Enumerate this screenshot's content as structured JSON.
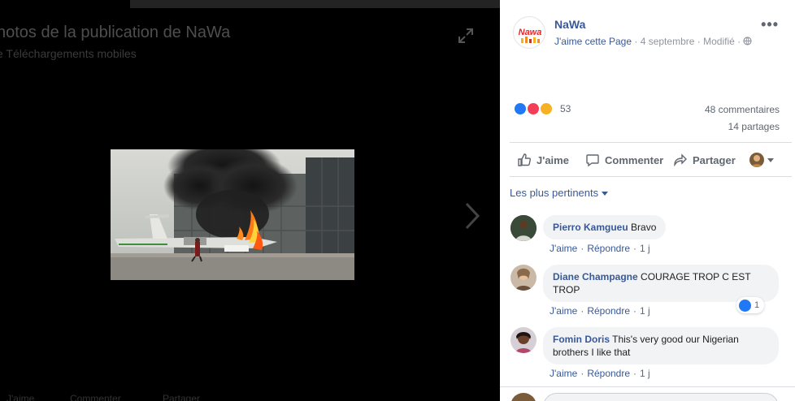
{
  "viewer": {
    "title": "hotos de la publication de NaWa",
    "subtitle": "e Téléchargements mobiles",
    "bottom_actions": [
      "J'aime",
      "Commenter",
      "Partager"
    ]
  },
  "post": {
    "page_name": "NaWa",
    "like_page": "J'aime cette Page",
    "date": "4 septembre",
    "edited": "Modifié",
    "privacy_icon": "globe-icon",
    "logo_text": "Nawa",
    "reaction_count": "53",
    "comments_count": "48 commentaires",
    "shares_count": "14 partages",
    "actions": {
      "like": "J'aime",
      "comment": "Commenter",
      "share": "Partager"
    }
  },
  "comments_section": {
    "filter_label": "Les plus pertinents",
    "comments": [
      {
        "author": "Pierro Kamgueu",
        "text": "Bravo",
        "like": "J'aime",
        "reply": "Répondre",
        "time": "1 j"
      },
      {
        "author": "Diane Champagne",
        "text": "COURAGE TROP C EST TROP",
        "like": "J'aime",
        "reply": "Répondre",
        "time": "1 j",
        "likes": "1"
      },
      {
        "author": "Fomin Doris",
        "text": "This's very good our Nigerian brothers I like that",
        "like": "J'aime",
        "reply": "Répondre",
        "time": "1 j"
      }
    ]
  },
  "colors": {
    "link": "#385898",
    "nawa_red": "#e2262a",
    "like_blue": "#2078f4",
    "love_red": "#f33e58",
    "sad_yellow": "#f7b125"
  }
}
